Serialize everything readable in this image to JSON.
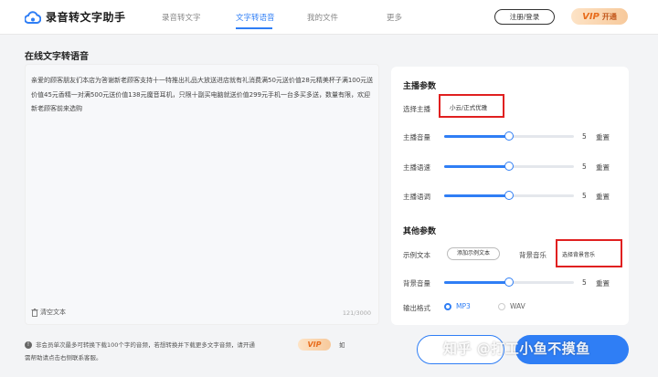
{
  "header": {
    "app_title": "录音转文字助手",
    "nav": [
      {
        "label": "录音转文字",
        "active": false
      },
      {
        "label": "文字转语音",
        "active": true
      },
      {
        "label": "我的文件",
        "active": false
      },
      {
        "label": "更多",
        "active": false
      }
    ],
    "login_label": "注册/登录",
    "vip_badge": "VIP",
    "vip_open": "开通"
  },
  "page_title": "在线文字转语音",
  "editor": {
    "content": "亲爱的顾客朋友们本店为答谢新老顾客支持十一特推出礼品大放送进店就有礼消费满50元送价值28元精美杯子满100元送价值45元香精一对满500元送价值138元魔音耳机，只限十副买电脑就送价值299元手机一台多买多送，数量有限，欢迎新老顾客前来选购",
    "clear_label": "清空文本",
    "counter": "121/3000"
  },
  "anchor_params": {
    "title": "主播参数",
    "select_label": "选择主播",
    "selected_anchor": "小云/正式优雅",
    "sliders": [
      {
        "label": "主播音量",
        "value": "5",
        "level": 0.5
      },
      {
        "label": "主播语速",
        "value": "5",
        "level": 0.5
      },
      {
        "label": "主播语调",
        "value": "5",
        "level": 0.5
      }
    ],
    "reset_label": "重置"
  },
  "other_params": {
    "title": "其他参数",
    "example_label": "示例文本",
    "add_example": "添加示例文本",
    "bgm_label": "背景音乐",
    "bgm_select": "选择背景音乐",
    "bgm_volume_label": "背景音量",
    "bgm_volume_value": "5",
    "bgm_volume_level": 0.5,
    "format_label": "输出格式",
    "formats": [
      {
        "label": "MP3",
        "selected": true
      },
      {
        "label": "WAV",
        "selected": false
      }
    ]
  },
  "footer": {
    "note_line1": "非会员单次最多可转换下载100个字的音频，若想转换并下载更多文字音频，请开通",
    "vip_badge": "VIP",
    "note_tail": "如",
    "note_line2": "需帮助请点击右侧联系客服。"
  },
  "watermark": "知乎 @打工小鱼不摸鱼",
  "colors": {
    "accent": "#2f7ef5",
    "highlight_box": "#e02020"
  }
}
